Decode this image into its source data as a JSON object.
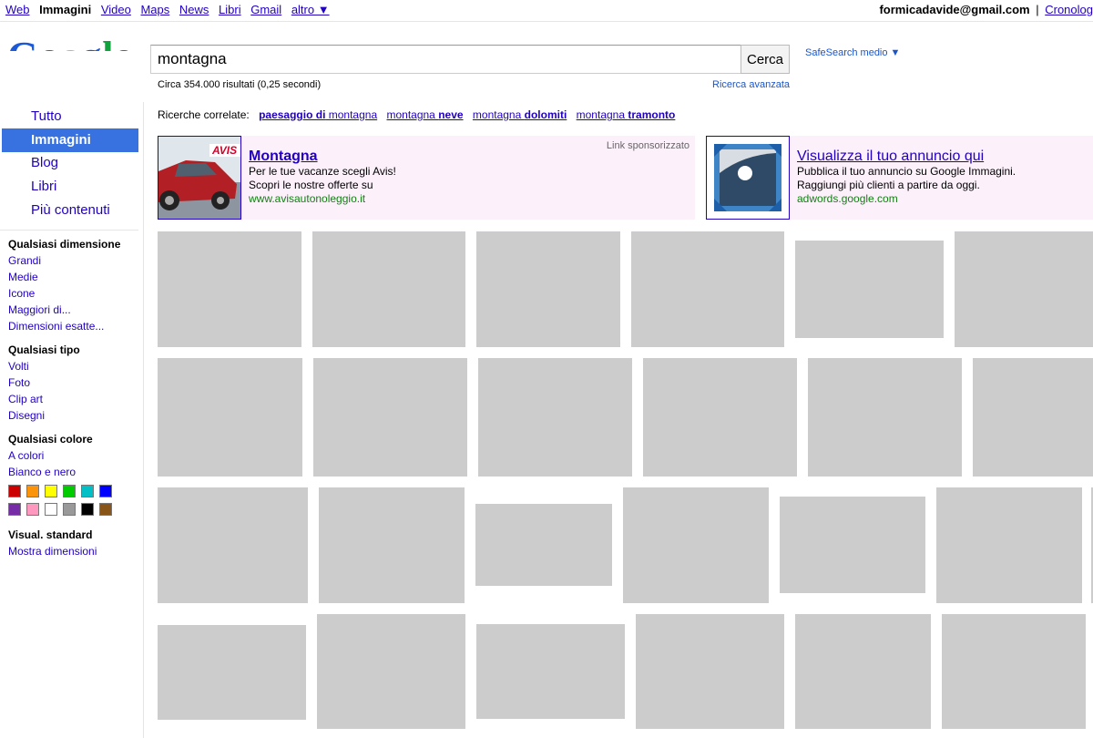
{
  "topnav": [
    {
      "label": "Web",
      "active": false
    },
    {
      "label": "Immagini",
      "active": true
    },
    {
      "label": "Video",
      "active": false
    },
    {
      "label": "Maps",
      "active": false
    },
    {
      "label": "News",
      "active": false
    },
    {
      "label": "Libri",
      "active": false
    },
    {
      "label": "Gmail",
      "active": false
    },
    {
      "label": "altro ▼",
      "active": false
    }
  ],
  "account": {
    "email": "formicadavide@gmail.com",
    "separator": "|",
    "history_label": "Cronolog"
  },
  "search": {
    "query": "montagna",
    "button": "Cerca",
    "safesearch": "SafeSearch medio ▼",
    "stats": "Circa 354.000 risultati (0,25 secondi)",
    "advanced": "Ricerca avanzata"
  },
  "sidebar": {
    "nav": [
      "Tutto",
      "Immagini",
      "Blog",
      "Libri",
      "Più contenuti"
    ],
    "size": {
      "head": "Qualsiasi dimensione",
      "items": [
        "Grandi",
        "Medie",
        "Icone",
        "Maggiori di...",
        "Dimensioni esatte..."
      ]
    },
    "type": {
      "head": "Qualsiasi tipo",
      "items": [
        "Volti",
        "Foto",
        "Clip art",
        "Disegni"
      ]
    },
    "color": {
      "head": "Qualsiasi colore",
      "items": [
        "A colori",
        "Bianco e nero"
      ],
      "swatches": [
        "#cc0000",
        "#fb940b",
        "#ffff00",
        "#00cc00",
        "#03c0c6",
        "#0000ff",
        "#762ca7",
        "#ff98bf",
        "#ffffff",
        "#999999",
        "#000000",
        "#885418"
      ]
    },
    "view": {
      "head": "Visual. standard",
      "items": [
        "Mostra dimensioni"
      ]
    }
  },
  "related": {
    "prefix": "Ricerche correlate:",
    "items": [
      {
        "normal": "",
        "bold": "paesaggio di",
        "tail": " montagna"
      },
      {
        "normal": "montagna ",
        "bold": "neve",
        "tail": ""
      },
      {
        "normal": "montagna ",
        "bold": "dolomiti",
        "tail": ""
      },
      {
        "normal": "montagna ",
        "bold": "tramonto",
        "tail": ""
      }
    ]
  },
  "ads": [
    {
      "title": "Montagna",
      "lines": [
        "Per le tue vacanze scegli Avis!",
        "Scopri le nostre offerte su"
      ],
      "url": "www.avisautonoleggio.it",
      "image_label": "AVIS",
      "sponsored": "Link sponsorizzato"
    },
    {
      "title": "Visualizza il tuo annuncio qui",
      "lines": [
        "Pubblica il tuo annuncio su Google Immagini.",
        "Raggiungi più clienti a partire da oggi."
      ],
      "url": "adwords.google.com"
    }
  ],
  "colors": {
    "link": "#2200c1",
    "active_nav": "#3872e0",
    "ad_bg": "#fcf1fb",
    "url_green": "#128012",
    "thumb": "#cccccc"
  }
}
